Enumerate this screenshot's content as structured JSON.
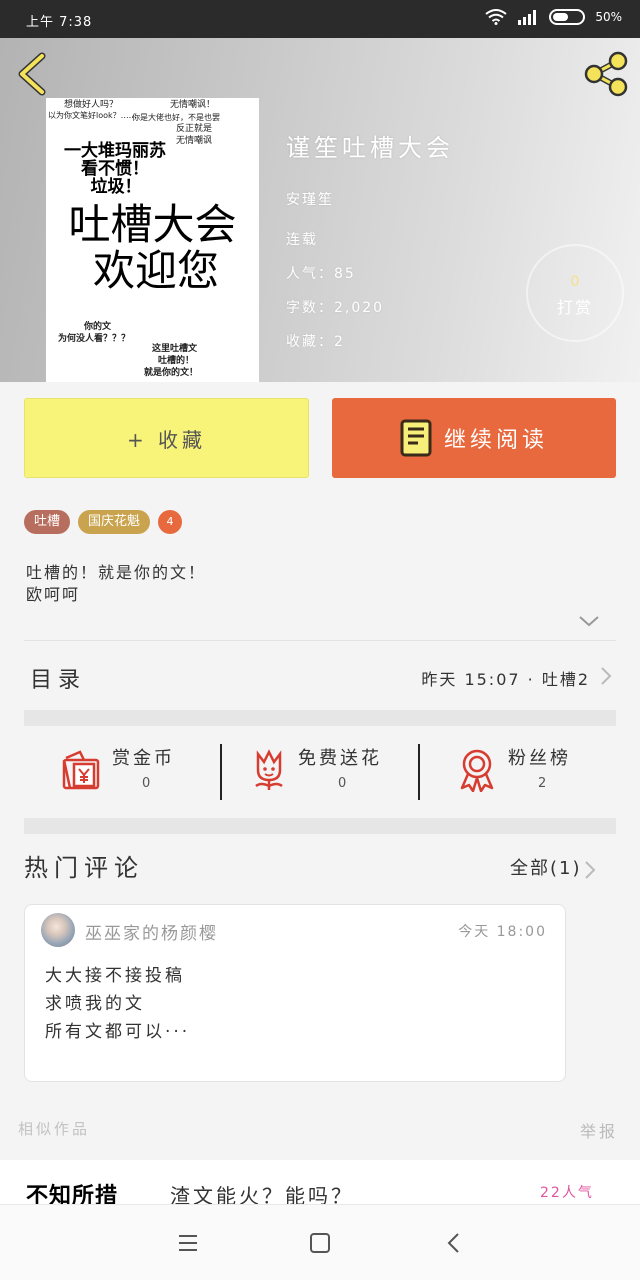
{
  "status_bar": {
    "time": "上午 7:38",
    "battery": "50%"
  },
  "header": {
    "cover_text": {
      "top_left_1": "想做好人吗？",
      "top_left_2": "以为你文笔好look？……",
      "top_right_1": "无情嘲讽！",
      "top_right_2": "你是大佬也好，不是也罢",
      "top_right_3": "反正就是",
      "top_right_4": "无情嘲讽",
      "big_1": "一大堆玛丽苏",
      "big_2": "看不惯！",
      "big_3": "垃圾！",
      "big_4": "吐槽大会",
      "big_5": "欢迎您",
      "bottom_left_1": "你的文",
      "bottom_left_2": "为何没人看？？？",
      "bottom_right_1": "这里吐槽文",
      "bottom_right_2": "吐槽的！",
      "bottom_right_3": "就是你的文！"
    },
    "title": "谨笙吐槽大会",
    "author": "安瑾笙",
    "status": "连载",
    "popularity": "人气：85",
    "word_count": "字数：2,020",
    "favorites": "收藏：2",
    "tip_count": "0",
    "tip_label": "打赏"
  },
  "actions": {
    "collect_label": "+ 收藏",
    "read_label": "继续阅读"
  },
  "tags": [
    "吐槽",
    "国庆花魁"
  ],
  "tag_count": "4",
  "description": [
    "吐槽的！就是你的文！",
    "欧呵呵"
  ],
  "catalog": {
    "label": "目录",
    "latest": "昨天 15:07 · 吐槽2"
  },
  "support": [
    {
      "label": "赏金币",
      "count": "0"
    },
    {
      "label": "免费送花",
      "count": "0"
    },
    {
      "label": "粉丝榜",
      "count": "2"
    }
  ],
  "comments": {
    "title": "热门评论",
    "all_label": "全部(1)",
    "items": [
      {
        "user": "巫巫家的杨颜樱",
        "time": "今天 18:00",
        "lines": [
          "大大接不接投稿",
          "求喷我的文",
          "所有文都可以···"
        ]
      }
    ]
  },
  "similar": {
    "label": "相似作品",
    "report_label": "举报",
    "items": [
      {
        "cover_text": "不知所措",
        "title": "渣文能火？能吗？",
        "popularity": "22人气"
      }
    ]
  },
  "colors": {
    "accent": "#e8693e",
    "collect_bg": "#f8f47a",
    "tip_gold": "#f5e08a",
    "popularity_pink": "#e054a0"
  }
}
